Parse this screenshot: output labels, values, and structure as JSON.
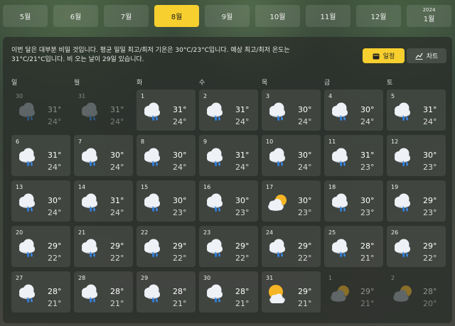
{
  "months": [
    {
      "label": "5월",
      "year": "",
      "active": false
    },
    {
      "label": "6월",
      "year": "",
      "active": false
    },
    {
      "label": "7월",
      "year": "",
      "active": false
    },
    {
      "label": "8월",
      "year": "",
      "active": true
    },
    {
      "label": "9월",
      "year": "",
      "active": false
    },
    {
      "label": "10월",
      "year": "",
      "active": false
    },
    {
      "label": "11월",
      "year": "",
      "active": false
    },
    {
      "label": "12월",
      "year": "",
      "active": false
    },
    {
      "label": "1월",
      "year": "2024",
      "active": false
    }
  ],
  "summary": "이번 달은 대부분 비일 것입니다. 평균 일일 최고/최저 기온은 30°C/23°C입니다. 예상 최고/최저 온도는 31°C/21°C입니다. 비 오는 날이 29일 있습니다.",
  "view_buttons": {
    "calendar": "일정",
    "chart": "차트"
  },
  "weekdays": [
    "일",
    "월",
    "화",
    "수",
    "목",
    "금",
    "토"
  ],
  "colors": {
    "accent": "#f7cf2e",
    "rain": "#2f7fe0"
  },
  "days": [
    {
      "day": "30",
      "hi": "31°",
      "lo": "24°",
      "icon": "rain-cloud-icon",
      "other": true
    },
    {
      "day": "31",
      "hi": "31°",
      "lo": "24°",
      "icon": "rain-cloud-icon",
      "other": true
    },
    {
      "day": "1",
      "hi": "31°",
      "lo": "24°",
      "icon": "rain-cloud-icon",
      "other": false
    },
    {
      "day": "2",
      "hi": "31°",
      "lo": "24°",
      "icon": "rain-cloud-icon",
      "other": false
    },
    {
      "day": "3",
      "hi": "30°",
      "lo": "24°",
      "icon": "rain-cloud-icon",
      "other": false
    },
    {
      "day": "4",
      "hi": "30°",
      "lo": "24°",
      "icon": "rain-cloud-icon",
      "other": false
    },
    {
      "day": "5",
      "hi": "31°",
      "lo": "24°",
      "icon": "rain-cloud-icon",
      "other": false
    },
    {
      "day": "6",
      "hi": "31°",
      "lo": "24°",
      "icon": "rain-cloud-icon",
      "other": false
    },
    {
      "day": "7",
      "hi": "30°",
      "lo": "24°",
      "icon": "rain-cloud-icon",
      "other": false
    },
    {
      "day": "8",
      "hi": "30°",
      "lo": "24°",
      "icon": "rain-cloud-icon",
      "other": false
    },
    {
      "day": "9",
      "hi": "31°",
      "lo": "24°",
      "icon": "rain-cloud-icon",
      "other": false
    },
    {
      "day": "10",
      "hi": "30°",
      "lo": "24°",
      "icon": "rain-cloud-icon",
      "other": false
    },
    {
      "day": "11",
      "hi": "31°",
      "lo": "23°",
      "icon": "rain-cloud-icon",
      "other": false
    },
    {
      "day": "12",
      "hi": "30°",
      "lo": "23°",
      "icon": "rain-cloud-icon",
      "other": false
    },
    {
      "day": "13",
      "hi": "30°",
      "lo": "24°",
      "icon": "rain-cloud-icon",
      "other": false
    },
    {
      "day": "14",
      "hi": "31°",
      "lo": "24°",
      "icon": "rain-cloud-icon",
      "other": false
    },
    {
      "day": "15",
      "hi": "30°",
      "lo": "23°",
      "icon": "rain-cloud-icon",
      "other": false
    },
    {
      "day": "16",
      "hi": "30°",
      "lo": "23°",
      "icon": "rain-cloud-icon",
      "other": false
    },
    {
      "day": "17",
      "hi": "30°",
      "lo": "23°",
      "icon": "partly-cloudy-icon",
      "other": false
    },
    {
      "day": "18",
      "hi": "30°",
      "lo": "23°",
      "icon": "rain-cloud-icon",
      "other": false
    },
    {
      "day": "19",
      "hi": "29°",
      "lo": "23°",
      "icon": "rain-cloud-icon",
      "other": false
    },
    {
      "day": "20",
      "hi": "29°",
      "lo": "22°",
      "icon": "rain-cloud-icon",
      "other": false
    },
    {
      "day": "21",
      "hi": "29°",
      "lo": "22°",
      "icon": "rain-cloud-icon",
      "other": false
    },
    {
      "day": "22",
      "hi": "29°",
      "lo": "22°",
      "icon": "rain-cloud-icon",
      "other": false
    },
    {
      "day": "23",
      "hi": "29°",
      "lo": "22°",
      "icon": "rain-cloud-icon",
      "other": false
    },
    {
      "day": "24",
      "hi": "29°",
      "lo": "22°",
      "icon": "rain-cloud-icon",
      "other": false
    },
    {
      "day": "25",
      "hi": "28°",
      "lo": "21°",
      "icon": "rain-cloud-icon",
      "other": false
    },
    {
      "day": "26",
      "hi": "29°",
      "lo": "22°",
      "icon": "rain-cloud-icon",
      "other": false
    },
    {
      "day": "27",
      "hi": "28°",
      "lo": "21°",
      "icon": "rain-cloud-icon",
      "other": false
    },
    {
      "day": "28",
      "hi": "28°",
      "lo": "21°",
      "icon": "rain-cloud-icon",
      "other": false
    },
    {
      "day": "29",
      "hi": "28°",
      "lo": "21°",
      "icon": "rain-cloud-icon",
      "other": false
    },
    {
      "day": "30",
      "hi": "28°",
      "lo": "21°",
      "icon": "rain-cloud-icon",
      "other": false
    },
    {
      "day": "31",
      "hi": "29°",
      "lo": "21°",
      "icon": "sun-cloud-icon",
      "other": false
    },
    {
      "day": "1",
      "hi": "29°",
      "lo": "21°",
      "icon": "partly-cloudy-icon",
      "other": true
    },
    {
      "day": "2",
      "hi": "28°",
      "lo": "20°",
      "icon": "partly-cloudy-icon",
      "other": true
    }
  ]
}
